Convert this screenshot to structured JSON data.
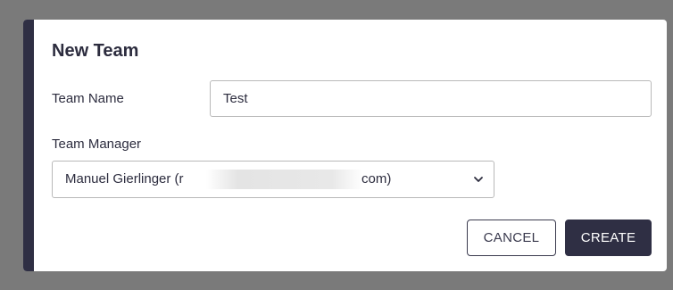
{
  "dialog": {
    "title": "New Team",
    "team_name": {
      "label": "Team Name",
      "value": "Test"
    },
    "team_manager": {
      "label": "Team Manager",
      "selected_prefix": "Manuel Gierlinger (r",
      "selected_suffix": "com)"
    },
    "buttons": {
      "cancel": "CANCEL",
      "create": "CREATE"
    }
  },
  "colors": {
    "accent": "#2f2f44",
    "overlay": "#7a7a7a",
    "text": "#2c2c3e"
  },
  "icons": {
    "select_chevron": "chevron-down-icon"
  }
}
